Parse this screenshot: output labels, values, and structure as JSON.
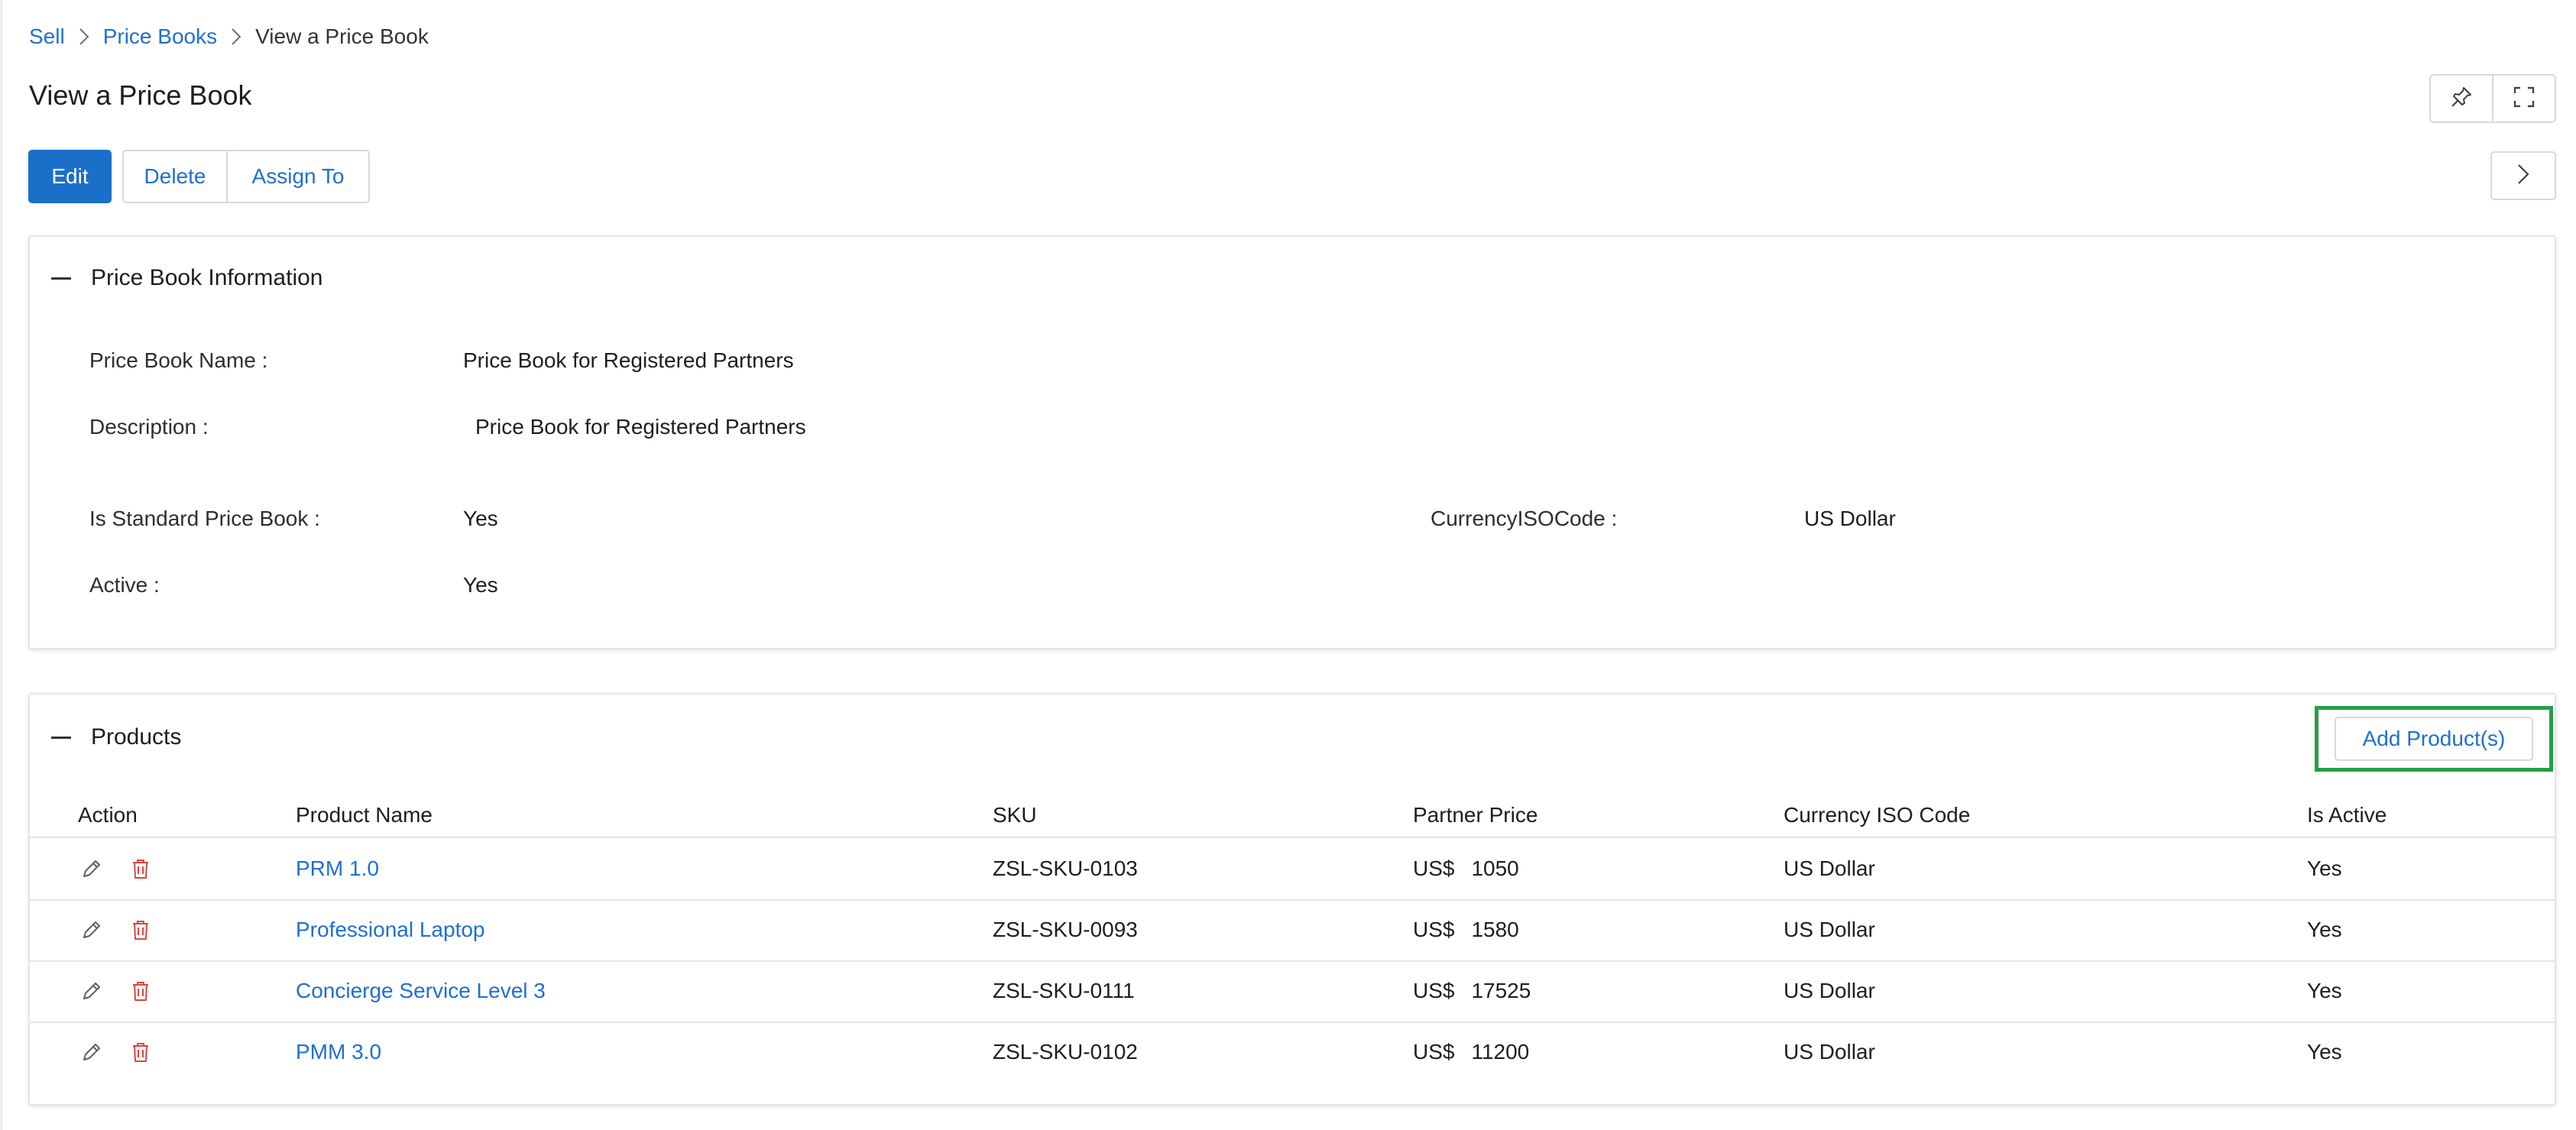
{
  "breadcrumb": {
    "items": [
      "Sell",
      "Price Books"
    ],
    "current": "View a Price Book"
  },
  "page": {
    "title": "View a Price Book"
  },
  "toolbar": {
    "edit_label": "Edit",
    "delete_label": "Delete",
    "assign_label": "Assign To"
  },
  "info": {
    "section_title": "Price Book Information",
    "fields": {
      "name": {
        "label": "Price Book Name :",
        "value": "Price Book for Registered Partners"
      },
      "description": {
        "label": "Description :",
        "value": "Price Book for Registered Partners"
      },
      "is_standard": {
        "label": "Is Standard Price Book :",
        "value": "Yes"
      },
      "currency": {
        "label": "CurrencyISOCode :",
        "value": "US Dollar"
      },
      "active": {
        "label": "Active :",
        "value": "Yes"
      }
    }
  },
  "products": {
    "section_title": "Products",
    "add_label": "Add Product(s)",
    "columns": [
      "Action",
      "Product Name",
      "SKU",
      "Partner Price",
      "Currency ISO Code",
      "Is Active"
    ],
    "rows": [
      {
        "name": "PRM 1.0",
        "sku": "ZSL-SKU-0103",
        "currency_symbol": "US$",
        "price": "1050",
        "currency": "US Dollar",
        "active": "Yes"
      },
      {
        "name": "Professional Laptop",
        "sku": "ZSL-SKU-0093",
        "currency_symbol": "US$",
        "price": "1580",
        "currency": "US Dollar",
        "active": "Yes"
      },
      {
        "name": "Concierge Service Level 3",
        "sku": "ZSL-SKU-0111",
        "currency_symbol": "US$",
        "price": "17525",
        "currency": "US Dollar",
        "active": "Yes"
      },
      {
        "name": "PMM 3.0",
        "sku": "ZSL-SKU-0102",
        "currency_symbol": "US$",
        "price": "11200",
        "currency": "US Dollar",
        "active": "Yes"
      }
    ]
  },
  "icons": {
    "pin": "pin-icon",
    "fullscreen": "fullscreen-icon",
    "next": "chevron-right-icon",
    "edit": "pencil-icon",
    "delete": "trash-icon"
  },
  "colors": {
    "primary": "#1a6fc9",
    "link": "#1f6fd1",
    "highlight": "#23a047",
    "danger": "#d9453f"
  }
}
